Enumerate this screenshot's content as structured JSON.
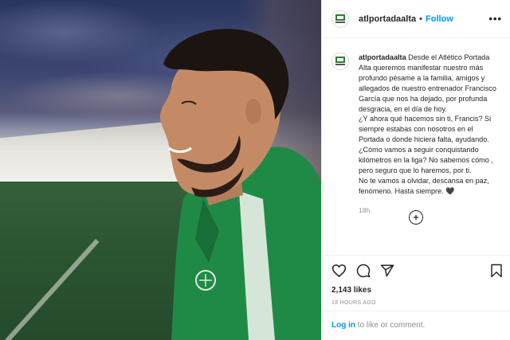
{
  "post": {
    "username": "atlportadaalta",
    "follow_label": "Follow",
    "separator": "•",
    "more_label": "•••"
  },
  "caption": {
    "username": "atlportadaalta",
    "lines": [
      "Desde el Atlético Portada Alta queremos manifestar nuestro más profundo pésame a la familia, amigos y allegados de nuestro entrenador Francisco García que nos ha dejado, por profunda desgracia, en el día de hoy.",
      "¿Y ahora qué hacemos sin ti, Francis? Si siempre estabas con nosotros en el Portada o donde hiciera falta, ayudando. ¿Cómo vamos a seguir conquistando kilómetros en la liga? No sabemos cómo , pero seguro que lo haremos, por ti.",
      "No te vamos a olvidar, descansa en paz, fenómeno. Hasta siempre. 🖤"
    ],
    "time": "18h"
  },
  "stats": {
    "likes": "2,143 likes",
    "posted_ago": "18 HOURS AGO"
  },
  "footer": {
    "login_label": "Log in",
    "suffix": " to like or comment."
  },
  "icons": [
    "heart-icon",
    "comment-icon",
    "share-icon",
    "bookmark-icon",
    "load-more-icon",
    "club-logo-icon"
  ],
  "colors": {
    "accent": "#0095f6",
    "text": "#262626",
    "muted": "#8e8e8e",
    "border": "#efefef"
  }
}
